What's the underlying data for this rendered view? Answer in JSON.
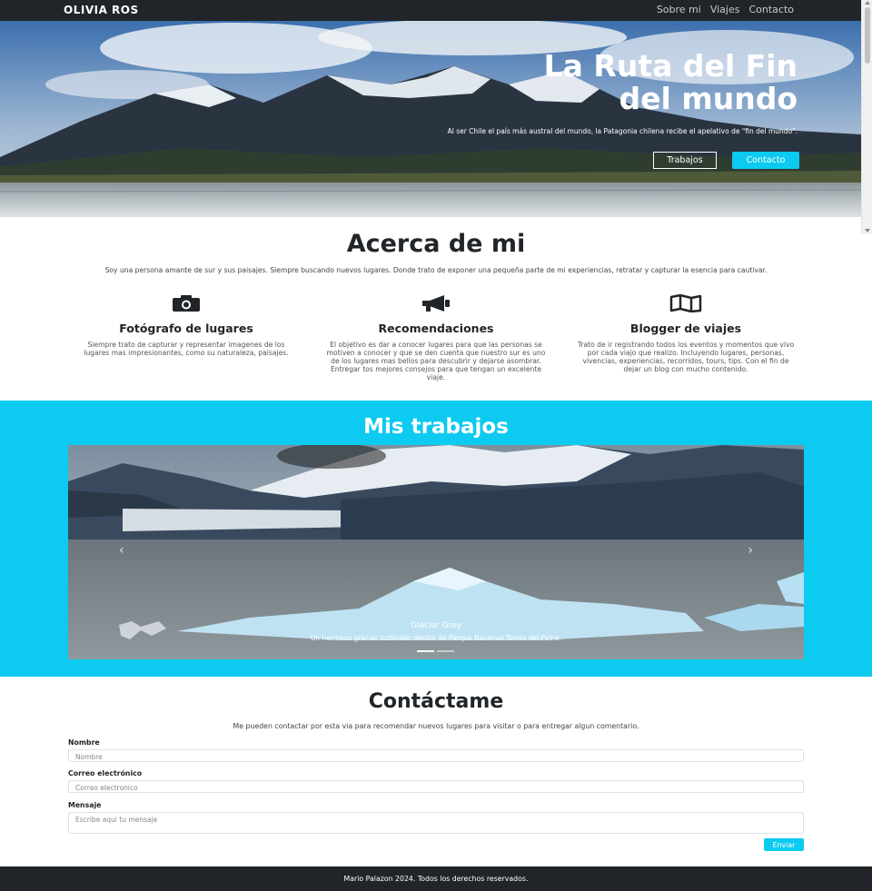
{
  "navbar": {
    "brand": "OLIVIA ROS",
    "links": [
      "Sobre mi",
      "Viajes",
      "Contacto"
    ]
  },
  "hero": {
    "title_line1": "La Ruta del Fin",
    "title_line2": "del mundo",
    "subtitle": "Al ser Chile el país más austral del mundo, la Patagonia chilena recibe el apelativo de \"fin del mundo\".",
    "btn_works": "Trabajos",
    "btn_contact": "Contacto"
  },
  "about": {
    "title": "Acerca de mi",
    "text": "Soy una persona amante de sur y sus paisajes. Siempre buscando nuevos lugares. Donde trato de exponer una pequeña parte de mi experiencias, retratar y capturar la esencia para cautivar.",
    "features": [
      {
        "icon": "camera-icon",
        "title": "Fotógrafo de lugares",
        "text": "Siempre trato de capturar y representar imagenes de los lugares mas impresionantes, como su naturaleza, paisajes."
      },
      {
        "icon": "megaphone-icon",
        "title": "Recomendaciones",
        "text": "El objetivo es dar a conocer lugares para que las personas se motiven a conocer y que se den cuenta que nuestro sur es uno de los lugares mas bellos para descubrir y dejarse asombrar. Entregar tos mejores consejos para que tengan un excelente viaje."
      },
      {
        "icon": "map-icon",
        "title": "Blogger de viajes",
        "text": "Trato de ir registrando todos los eventos y momentos que vivo por cada viajo que realizo. Incluyendo lugares, personas, vivencias, experiencias, recorridos, tours, tips. Con el fin de dejar un blog con mucho contenido."
      }
    ]
  },
  "works": {
    "title": "Mis trabajos",
    "slide": {
      "caption_title": "Glaciar Grey",
      "caption_text": "Un hermoso graciar hubicado dentro de Parque Nacional Torres del Paine."
    },
    "prev": "‹",
    "next": "›"
  },
  "contact": {
    "title": "Contáctame",
    "text": "Me pueden contactar por esta via para recomendar nuevos lugares para visitar o para entregar algun comentario.",
    "name_label": "Nombre",
    "name_placeholder": "Nombre",
    "email_label": "Correo electrónico",
    "email_placeholder": "Correo electronico",
    "message_label": "Mensaje",
    "message_placeholder": "Escribe aqui tu mensaje",
    "send": "Enviar"
  },
  "footer": {
    "text": "Mario Palazon 2024. Todos los derechos reservados."
  },
  "colors": {
    "accent": "#0dcaf0",
    "dark": "#212529"
  }
}
